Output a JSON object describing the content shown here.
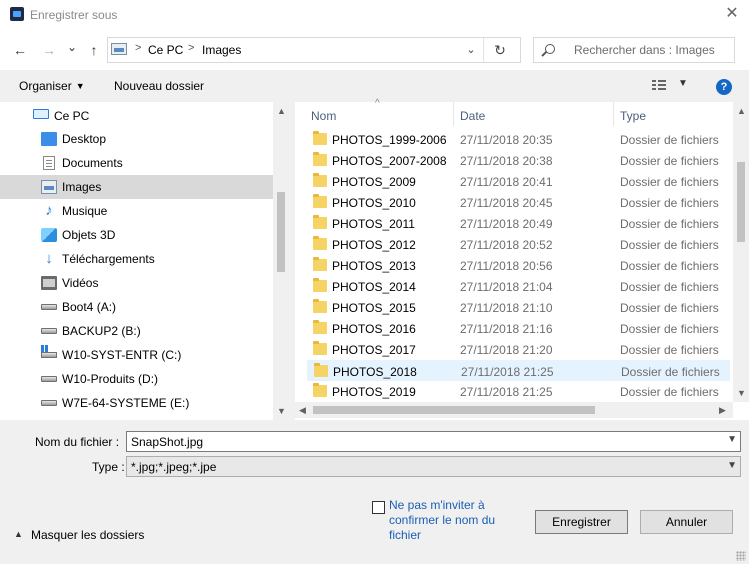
{
  "window": {
    "title": "Enregistrer sous",
    "close_glyph": "✕"
  },
  "nav": {
    "back": "←",
    "forward": "→",
    "recent": "⌄",
    "up": "↑",
    "breadcrumb": [
      "Ce PC",
      "Images"
    ],
    "separator": ">",
    "dropdown": "⌄",
    "refresh": "↻",
    "search_placeholder": "Rechercher dans : Images"
  },
  "toolbar": {
    "organize": "Organiser",
    "new_folder": "Nouveau dossier",
    "help": "?"
  },
  "sidebar": {
    "items": [
      {
        "label": "Ce PC",
        "icon": "computer-icon"
      },
      {
        "label": "Desktop",
        "icon": "desktop-icon"
      },
      {
        "label": "Documents",
        "icon": "documents-icon"
      },
      {
        "label": "Images",
        "icon": "pictures-icon",
        "selected": true
      },
      {
        "label": "Musique",
        "icon": "music-icon"
      },
      {
        "label": "Objets 3D",
        "icon": "3d-objects-icon"
      },
      {
        "label": "Téléchargements",
        "icon": "downloads-icon"
      },
      {
        "label": "Vidéos",
        "icon": "videos-icon"
      },
      {
        "label": "Boot4 (A:)",
        "icon": "drive-icon"
      },
      {
        "label": "BACKUP2 (B:)",
        "icon": "drive-icon"
      },
      {
        "label": "W10-SYST-ENTR (C:)",
        "icon": "windows-drive-icon"
      },
      {
        "label": "W10-Produits (D:)",
        "icon": "drive-icon"
      },
      {
        "label": "W7E-64-SYSTEME (E:)",
        "icon": "drive-icon"
      }
    ]
  },
  "files": {
    "columns": {
      "name": "Nom",
      "date": "Date",
      "type": "Type"
    },
    "rows": [
      {
        "name": "PHOTOS_1999-2006",
        "date": "27/11/2018 20:35",
        "type": "Dossier de fichiers"
      },
      {
        "name": "PHOTOS_2007-2008",
        "date": "27/11/2018 20:38",
        "type": "Dossier de fichiers"
      },
      {
        "name": "PHOTOS_2009",
        "date": "27/11/2018 20:41",
        "type": "Dossier de fichiers"
      },
      {
        "name": "PHOTOS_2010",
        "date": "27/11/2018 20:45",
        "type": "Dossier de fichiers"
      },
      {
        "name": "PHOTOS_2011",
        "date": "27/11/2018 20:49",
        "type": "Dossier de fichiers"
      },
      {
        "name": "PHOTOS_2012",
        "date": "27/11/2018 20:52",
        "type": "Dossier de fichiers"
      },
      {
        "name": "PHOTOS_2013",
        "date": "27/11/2018 20:56",
        "type": "Dossier de fichiers"
      },
      {
        "name": "PHOTOS_2014",
        "date": "27/11/2018 21:04",
        "type": "Dossier de fichiers"
      },
      {
        "name": "PHOTOS_2015",
        "date": "27/11/2018 21:10",
        "type": "Dossier de fichiers"
      },
      {
        "name": "PHOTOS_2016",
        "date": "27/11/2018 21:16",
        "type": "Dossier de fichiers"
      },
      {
        "name": "PHOTOS_2017",
        "date": "27/11/2018 21:20",
        "type": "Dossier de fichiers"
      },
      {
        "name": "PHOTOS_2018",
        "date": "27/11/2018 21:25",
        "type": "Dossier de fichiers",
        "selected": true
      },
      {
        "name": "PHOTOS_2019",
        "date": "27/11/2018 21:25",
        "type": "Dossier de fichiers"
      }
    ]
  },
  "form": {
    "filename_label": "Nom du fichier :",
    "filename_value": "SnapShot.jpg",
    "type_label": "Type :",
    "type_value": "*.jpg;*.jpeg;*.jpe",
    "dont_prompt": "Ne pas m'inviter à confirmer le nom du fichier",
    "hide_folders": "Masquer les dossiers",
    "save": "Enregistrer",
    "cancel": "Annuler"
  },
  "colors": {
    "accent": "#1467c4",
    "selected_row": "#e5f3ff",
    "selected_nav": "#d9d9d9",
    "folder": "#f6d365"
  }
}
